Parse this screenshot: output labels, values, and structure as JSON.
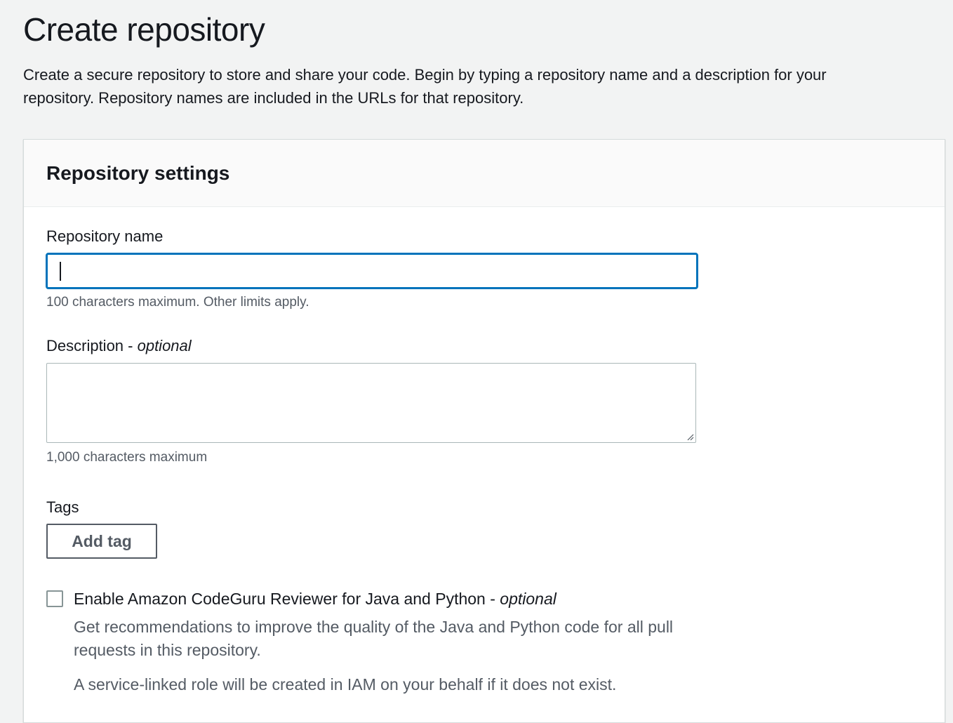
{
  "page": {
    "title": "Create repository",
    "description": "Create a secure repository to store and share your code. Begin by typing a repository name and a description for your repository. Repository names are included in the URLs for that repository."
  },
  "repository_settings": {
    "title": "Repository settings",
    "repository_name": {
      "label": "Repository name",
      "value": "",
      "constraint": "100 characters maximum. Other limits apply."
    },
    "description": {
      "label": "Description - ",
      "optional_label": "optional",
      "value": "",
      "constraint": "1,000 characters maximum"
    },
    "tags": {
      "label": "Tags",
      "add_button_label": "Add tag"
    },
    "codeguru": {
      "checked": false,
      "label": "Enable Amazon CodeGuru Reviewer for Java and Python - ",
      "optional_label": "optional",
      "description": "Get recommendations to improve the quality of the Java and Python code for all pull requests in this repository.",
      "note": "A service-linked role will be created in IAM on your behalf if it does not exist."
    }
  },
  "colors": {
    "page_background": "#f2f3f3",
    "focus_border": "#0073bb",
    "secondary_text": "#545b64"
  }
}
